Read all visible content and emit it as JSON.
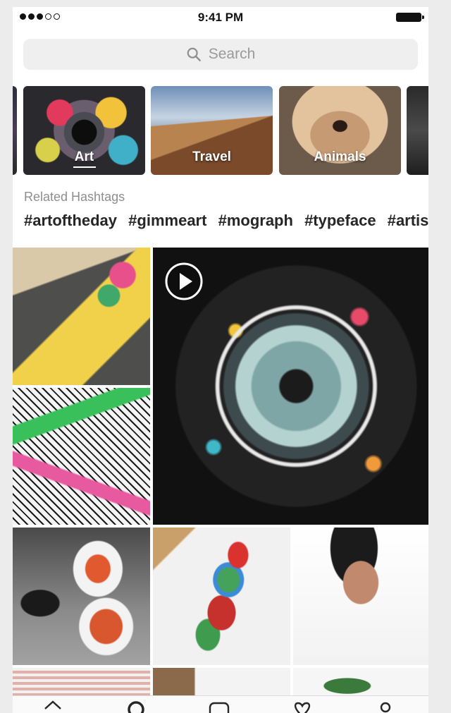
{
  "status_bar": {
    "time": "9:41 PM",
    "signal_dots_filled": 3,
    "signal_dots_total": 5
  },
  "search": {
    "placeholder": "Search",
    "icon": "search-icon"
  },
  "topics": [
    {
      "label": "Art",
      "selected": true
    },
    {
      "label": "Travel",
      "selected": false
    },
    {
      "label": "Animals",
      "selected": false
    }
  ],
  "related": {
    "title": "Related Hashtags",
    "hashtags": [
      "#artoftheday",
      "#gimmeart",
      "#mograph",
      "#typeface",
      "#artis"
    ]
  },
  "grid": {
    "video_icon": "play-icon"
  },
  "tab_bar": {
    "icons": [
      "home-icon",
      "search-icon",
      "add-post-icon",
      "heart-icon",
      "profile-icon"
    ]
  },
  "colors": {
    "background": "#ffffff",
    "search_bg": "#efefef",
    "text_dark": "#262626",
    "text_muted": "#8e8e8e"
  }
}
